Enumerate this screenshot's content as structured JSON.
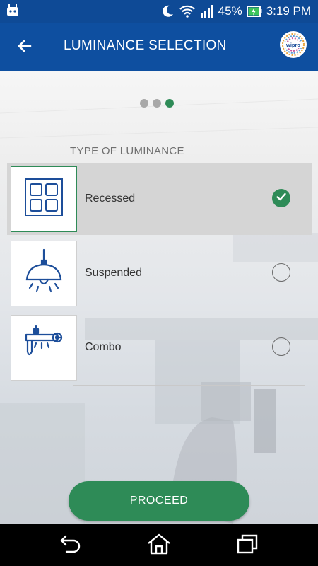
{
  "status_bar": {
    "battery": "45%",
    "time": "3:19 PM",
    "icons": [
      "android-notification-icon",
      "moon-icon",
      "wifi-icon",
      "signal-icon",
      "battery-charging-icon"
    ]
  },
  "app_bar": {
    "title": "LUMINANCE SELECTION",
    "back_icon": "arrow-left-icon",
    "logo_text": "wipro"
  },
  "pager": {
    "total": 3,
    "active_index": 2
  },
  "section": {
    "label": "TYPE OF LUMINANCE"
  },
  "options": [
    {
      "label": "Recessed",
      "icon": "recessed-light-icon",
      "selected": true
    },
    {
      "label": "Suspended",
      "icon": "suspended-lamp-icon",
      "selected": false
    },
    {
      "label": "Combo",
      "icon": "combo-fixture-icon",
      "selected": false
    }
  ],
  "proceed_button": {
    "label": "PROCEED"
  },
  "nav_bar": {
    "icons": [
      "back-nav-icon",
      "home-nav-icon",
      "recents-nav-icon"
    ]
  },
  "colors": {
    "primary": "#0e4fa0",
    "accent": "#2e8b57",
    "icon_blue": "#1d4e9a"
  }
}
